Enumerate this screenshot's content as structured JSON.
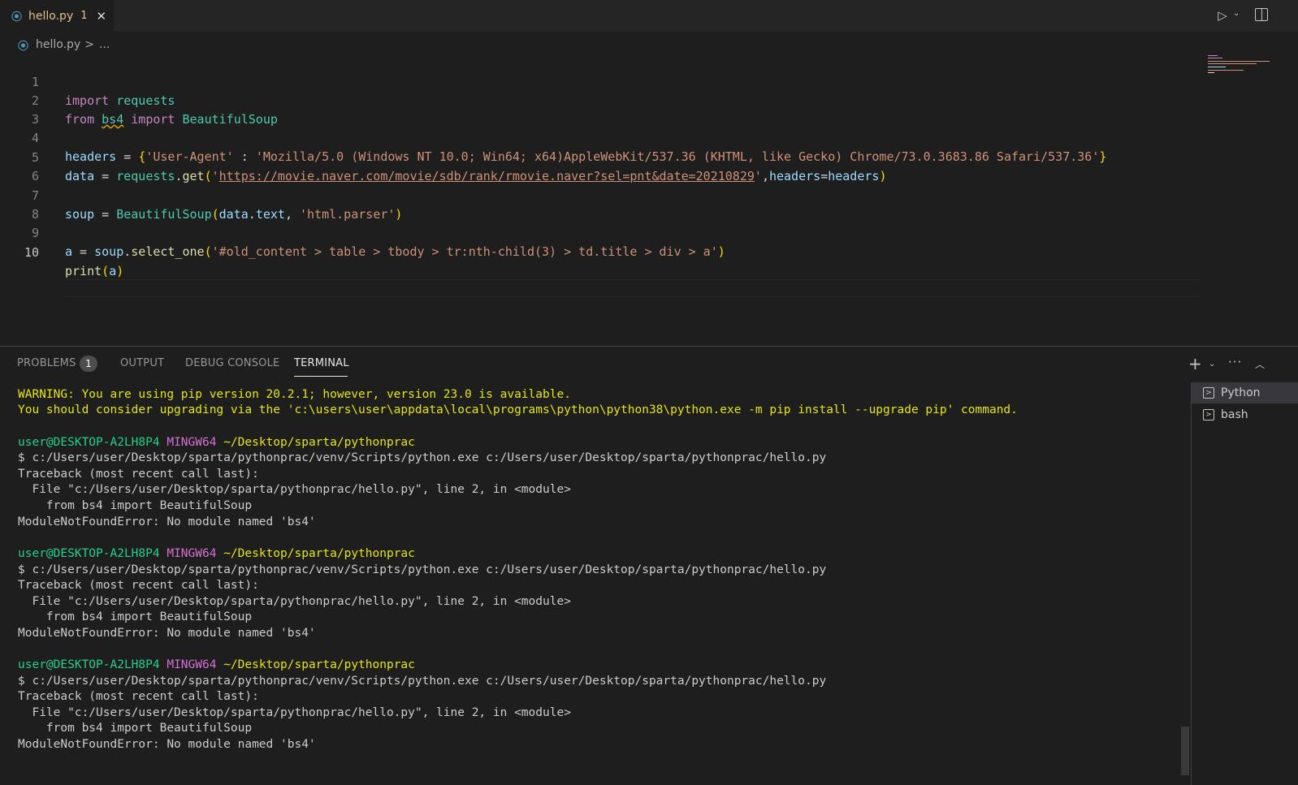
{
  "tab": {
    "label": "hello.py",
    "badge": "1",
    "close": "✕"
  },
  "toolbar": {
    "run_icon": "play-icon",
    "split_icon": "split-editor-icon"
  },
  "breadcrumb": {
    "file": "hello.py",
    "sep": ">",
    "more": "..."
  },
  "editor": {
    "line_numbers": [
      "1",
      "2",
      "3",
      "4",
      "5",
      "6",
      "7",
      "8",
      "9",
      "10"
    ],
    "active_line": 10,
    "lines": {
      "l1": [
        "import",
        " ",
        "requests"
      ],
      "l2": [
        "from",
        " ",
        "bs4",
        " ",
        "import",
        " ",
        "BeautifulSoup"
      ],
      "l4": [
        "headers",
        " = ",
        "{",
        "'User-Agent'",
        " : ",
        "'Mozilla/5.0 (Windows NT 10.0; Win64; x64)AppleWebKit/537.36 (KHTML, like Gecko) Chrome/73.0.3683.86 Safari/537.36'",
        "}"
      ],
      "l5": [
        "data",
        " = ",
        "requests",
        ".",
        "get",
        "(",
        "'",
        "https://movie.naver.com/movie/sdb/rank/rmovie.naver?sel=pnt&date=20210829",
        "'",
        ",",
        "headers",
        "=",
        "headers",
        ")"
      ],
      "l7": [
        "soup",
        " = ",
        "BeautifulSoup",
        "(",
        "data",
        ".",
        "text",
        ", ",
        "'html.parser'",
        ")"
      ],
      "l9": [
        "a",
        " = ",
        "soup",
        ".",
        "select_one",
        "(",
        "'#old_content > table > tbody > tr:nth-child(3) > td.title > div > a'",
        ")"
      ],
      "l10": [
        "print",
        "(",
        "a",
        ")"
      ]
    }
  },
  "panel": {
    "tabs": [
      "PROBLEMS",
      "OUTPUT",
      "DEBUG CONSOLE",
      "TERMINAL"
    ],
    "problems_count": "1",
    "active_tab": "TERMINAL"
  },
  "terminal": {
    "warning1": "WARNING: You are using pip version 20.2.1; however, version 23.0 is available.",
    "warning2": "You should consider upgrading via the 'c:\\users\\user\\appdata\\local\\programs\\python\\python38\\python.exe -m pip install --upgrade pip' command.",
    "prompt_user": "user@DESKTOP-A2LH8P4",
    "prompt_shell": "MINGW64",
    "prompt_path": "~/Desktop/sparta/pythonprac",
    "command": "$ c:/Users/user/Desktop/sparta/pythonprac/venv/Scripts/python.exe c:/Users/user/Desktop/sparta/pythonprac/hello.py",
    "traceback": "Traceback (most recent call last):",
    "file_line": "  File \"c:/Users/user/Desktop/sparta/pythonprac/hello.py\", line 2, in <module>",
    "code_line": "    from bs4 import BeautifulSoup",
    "error": "ModuleNotFoundError: No module named 'bs4'"
  },
  "terminal_list": {
    "items": [
      "Python",
      "bash"
    ],
    "active": "Python"
  }
}
